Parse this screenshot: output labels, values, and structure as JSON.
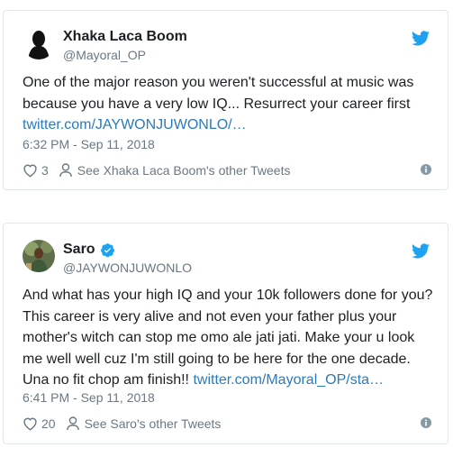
{
  "colors": {
    "link": "#2b7bb9",
    "muted": "#697882",
    "text": "#1c2022",
    "twitter_blue": "#1da1f2",
    "border": "#e1e8ed"
  },
  "tweets": [
    {
      "author_name": "Xhaka Laca Boom",
      "author_handle": "@Mayoral_OP",
      "verified": false,
      "text_lines": [
        "One of the major reason you weren't successful at music was",
        "because you have a very low IQ... Resurrect your career first"
      ],
      "link": "twitter.com/JAYWONJUWONLO/…",
      "timestamp": "6:32 PM - Sep 11, 2018",
      "likes": "3",
      "other_tweets_label": "See Xhaka Laca Boom's other Tweets",
      "icons": [
        "avatar",
        "twitter-bird-icon",
        "heart-icon",
        "person-icon",
        "info-icon"
      ]
    },
    {
      "author_name": "Saro",
      "author_handle": "@JAYWONJUWONLO",
      "verified": true,
      "text_lines": [
        "And what has your high IQ and your 10k followers done for you?",
        "This career is very alive and not even your father plus your",
        "mother's witch can stop me omo ale jati jati.  Make your u look",
        "me well well cuz I'm still going to be here for the one decade."
      ],
      "last_line_prefix": "Una no fit chop am finish!! ",
      "link": "twitter.com/Mayoral_OP/sta…",
      "timestamp": "6:41 PM - Sep 11, 2018",
      "likes": "20",
      "other_tweets_label": "See Saro's other Tweets",
      "icons": [
        "avatar",
        "verified-badge-icon",
        "twitter-bird-icon",
        "heart-icon",
        "person-icon",
        "info-icon"
      ]
    }
  ]
}
